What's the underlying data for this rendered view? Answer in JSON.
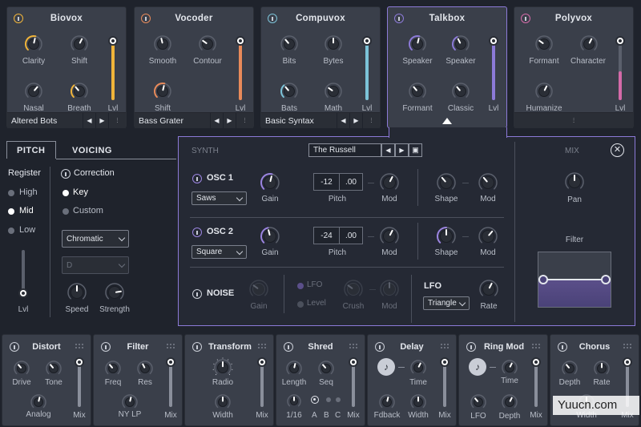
{
  "colors": {
    "biovox": "#f0b43a",
    "vocoder": "#e88a5a",
    "compuvox": "#7cc3d8",
    "talkbox": "#8c7ad8",
    "polyvox": "#d46aa8",
    "osc": "#9b84e0"
  },
  "voices": [
    {
      "title": "Biovox",
      "knobs": [
        "Clarity",
        "Shift",
        "Nasal",
        "Breath"
      ],
      "lvl": "Lvl",
      "preset": "Altered Bots",
      "icons": [
        "power-icon",
        "prev-arrow-icon",
        "next-arrow-icon",
        "sliders-icon"
      ]
    },
    {
      "title": "Vocoder",
      "knobs": [
        "Smooth",
        "Contour",
        "Shift"
      ],
      "lvl": "Lvl",
      "preset": "Bass Grater"
    },
    {
      "title": "Compuvox",
      "knobs": [
        "Bits",
        "Bytes",
        "Bats",
        "Math"
      ],
      "lvl": "Lvl",
      "preset": "Basic Syntax"
    },
    {
      "title": "Talkbox",
      "knobs": [
        "Speaker",
        "Speaker",
        "Formant",
        "Classic"
      ],
      "lvl": "Lvl"
    },
    {
      "title": "Polyvox",
      "knobs": [
        "Formant",
        "Character",
        "Humanize"
      ],
      "lvl": "Lvl"
    }
  ],
  "tabs": {
    "pitch": "PITCH",
    "voicing": "VOICING"
  },
  "pitch": {
    "register": "Register",
    "reg_opts": [
      "High",
      "Mid",
      "Low"
    ],
    "reg_selected": "Mid",
    "correction": "Correction",
    "corr_opts": [
      "Key",
      "Custom"
    ],
    "corr_selected": "Key",
    "scale": "Chromatic",
    "key": "D",
    "lvl": "Lvl",
    "speed": "Speed",
    "strength": "Strength"
  },
  "synth": {
    "label": "SYNTH",
    "preset": "The Russell",
    "mix_label": "MIX",
    "pan": "Pan",
    "filter": "Filter",
    "osc1": {
      "name": "OSC 1",
      "wave": "Saws",
      "gain": "Gain",
      "pitch_a": "-12",
      "pitch_b": ".00",
      "pitch": "Pitch",
      "mod": "Mod",
      "shape": "Shape",
      "mod2": "Mod"
    },
    "osc2": {
      "name": "OSC 2",
      "wave": "Square",
      "gain": "Gain",
      "pitch_a": "-24",
      "pitch_b": ".00",
      "pitch": "Pitch",
      "mod": "Mod",
      "shape": "Shape",
      "mod2": "Mod"
    },
    "noise": {
      "name": "NOISE",
      "gain": "Gain",
      "lfo": "LFO",
      "level": "Level",
      "crush": "Crush",
      "mod": "Mod"
    },
    "lfo": {
      "name": "LFO",
      "wave": "Triangle",
      "rate": "Rate"
    }
  },
  "effects": [
    {
      "title": "Distort",
      "labels": [
        "Drive",
        "Tone",
        "Analog",
        "Mix"
      ]
    },
    {
      "title": "Filter",
      "labels": [
        "Freq",
        "Res",
        "NY LP",
        "Mix"
      ]
    },
    {
      "title": "Transform",
      "labels": [
        "Radio",
        "Width",
        "Mix"
      ]
    },
    {
      "title": "Shred",
      "labels": [
        "Length",
        "Seq",
        "1/16",
        "A",
        "B",
        "C",
        "Mix"
      ]
    },
    {
      "title": "Delay",
      "labels": [
        "Time",
        "Fdback",
        "Width",
        "Mix"
      ]
    },
    {
      "title": "Ring Mod",
      "labels": [
        "Time",
        "LFO",
        "Depth",
        "Mix"
      ]
    },
    {
      "title": "Chorus",
      "labels": [
        "Depth",
        "Rate",
        "Width",
        "Mix"
      ]
    }
  ],
  "watermark": "Yuucn.com"
}
